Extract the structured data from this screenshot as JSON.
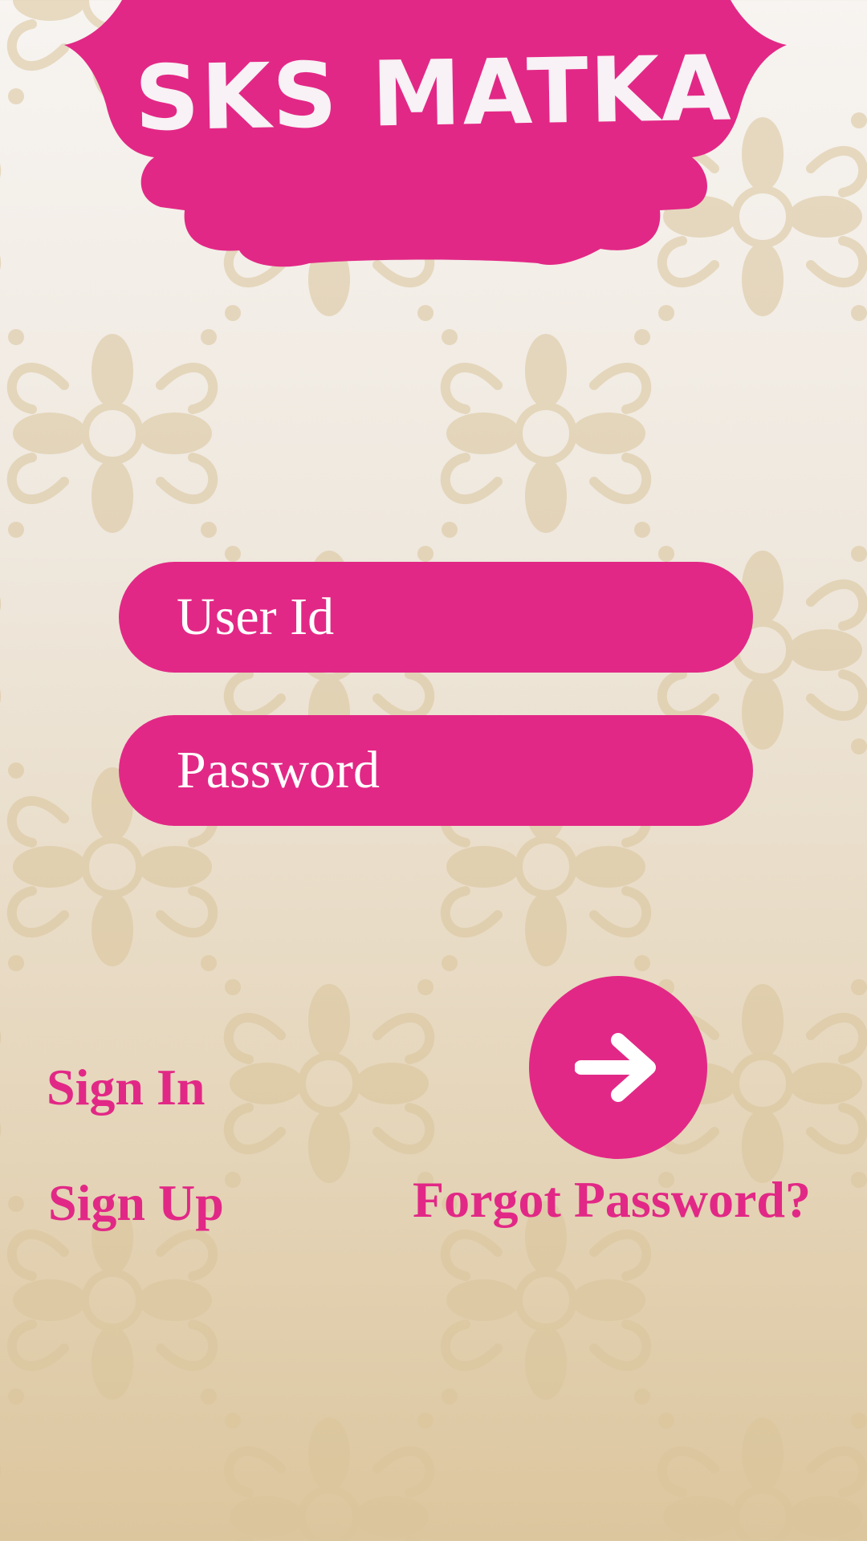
{
  "app": {
    "title": "SKS MATKA"
  },
  "form": {
    "user_id_placeholder": "User Id",
    "password_placeholder": "Password"
  },
  "actions": {
    "sign_in": "Sign In",
    "sign_up": "Sign Up",
    "forgot_password": "Forgot Password?",
    "submit_icon": "arrow-right-icon"
  },
  "colors": {
    "accent": "#e22886",
    "text_on_accent": "#ffffff",
    "background_top": "#f7f4f1",
    "background_bottom": "#dcc69e"
  }
}
